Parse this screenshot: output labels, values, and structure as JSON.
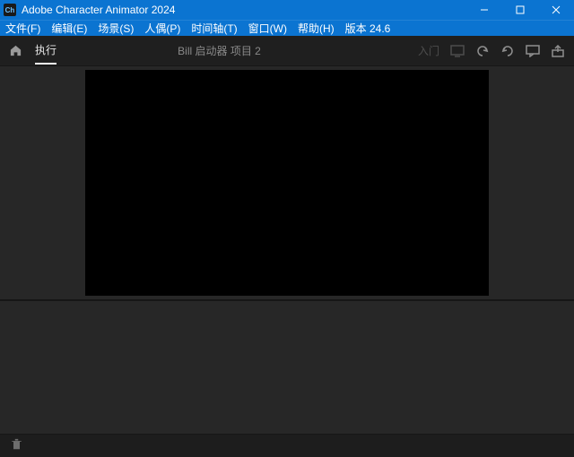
{
  "window": {
    "app_icon_text": "Ch",
    "title": "Adobe Character Animator 2024"
  },
  "menu": {
    "file": "文件(F)",
    "edit": "编辑(E)",
    "scene": "场景(S)",
    "puppet": "人偶(P)",
    "timeline": "时间轴(T)",
    "window": "窗口(W)",
    "help": "帮助(H)",
    "version": "版本 24.6"
  },
  "appbar": {
    "tab_perform": "执行",
    "scene_title": "Bill 启动器 项目 2",
    "intro_label": "入门"
  },
  "colors": {
    "titlebar": "#0b74d1",
    "body": "#272727",
    "stage": "#000000"
  }
}
